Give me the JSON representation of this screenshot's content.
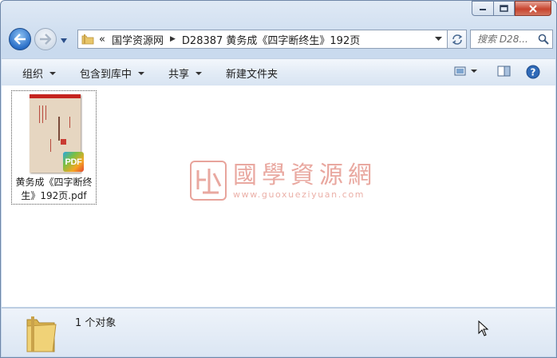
{
  "window": {
    "caption_buttons": [
      "minimize",
      "maximize",
      "close"
    ]
  },
  "nav": {
    "back_icon": "arrow-left-icon",
    "forward_icon": "arrow-right-icon",
    "breadcrumb": {
      "overflow": "«",
      "items": [
        "国学资源网",
        "D28387 黄务成《四字断终生》192页"
      ]
    },
    "search": {
      "placeholder": "搜索 D28..."
    }
  },
  "toolbar": {
    "organize": "组织",
    "include_in_library": "包含到库中",
    "share": "共享",
    "new_folder": "新建文件夹",
    "right_icons": [
      "change-view-icon",
      "preview-pane-icon",
      "help-icon"
    ]
  },
  "files": [
    {
      "name_line1": "黄务成《四字断终",
      "name_line2": "生》192页.pdf",
      "thumbnail_title": "四字断终生",
      "badge": "PDF"
    }
  ],
  "watermark": {
    "name": "國學資源網",
    "url": "www.guoxueziyuan.com"
  },
  "status": {
    "item_count": "1 个对象"
  },
  "colors": {
    "accent": "#2a6fc8",
    "close_button": "#c7442e",
    "watermark": "#e9a8a0",
    "pdf_cover": "#e6d6c1"
  }
}
